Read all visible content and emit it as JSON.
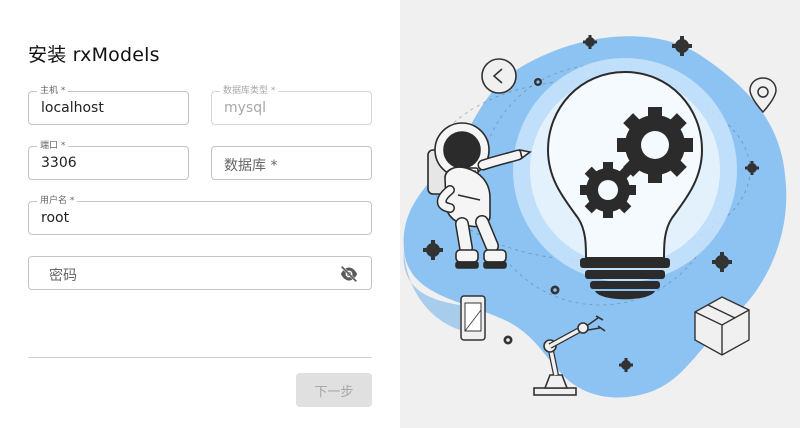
{
  "form": {
    "title": "安装 rxModels",
    "host": {
      "label": "主机 *",
      "value": "localhost"
    },
    "db_type": {
      "label": "数据库类型 *",
      "value": "mysql"
    },
    "port": {
      "label": "端口 *",
      "value": "3306"
    },
    "database": {
      "placeholder": "数据库 *"
    },
    "username": {
      "label": "用户名 *",
      "value": "root"
    },
    "password": {
      "placeholder": "密码",
      "toggle_icon": "eye-off-icon"
    },
    "next_button": "下一步"
  },
  "colors": {
    "blob_blue": "#8cc3f2",
    "bulb_glow": "#d7ecfd",
    "dark_gear": "#2b2b2b",
    "panel_bg": "#f0f0f0",
    "button_disabled": "#e0e0e0"
  },
  "illustration": {
    "icons": [
      "lightbulb-icon",
      "gear-icon",
      "astronaut-icon",
      "robot-arm-icon",
      "phone-icon",
      "clock-icon",
      "location-pin-icon",
      "box-icon"
    ]
  }
}
